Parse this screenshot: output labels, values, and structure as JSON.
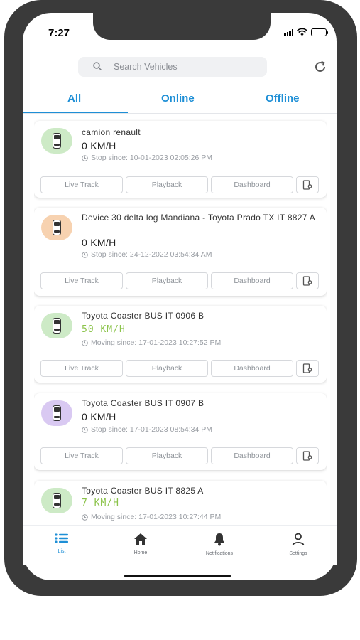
{
  "status_bar": {
    "time": "7:27"
  },
  "search": {
    "placeholder": "Search Vehicles"
  },
  "tabs": [
    {
      "label": "All",
      "active": true
    },
    {
      "label": "Online",
      "active": false
    },
    {
      "label": "Offline",
      "active": false
    }
  ],
  "colors": {
    "accent": "#1e8fd6",
    "moving": "#8bc34a",
    "avatar_green": "#cdeac6",
    "avatar_orange": "#f7d2b0",
    "avatar_purple": "#d9c9f2"
  },
  "actions": {
    "live_track": "Live Track",
    "playback": "Playback",
    "dashboard": "Dashboard"
  },
  "vehicles": [
    {
      "name": "camion renault",
      "speed": "0 KM/H",
      "since": "Stop since: 10-01-2023 02:05:26 PM",
      "status": "stopped",
      "avatar_color": "green"
    },
    {
      "name": "Device 30 delta log Mandiana - Toyota Prado TX IT 8827 A",
      "speed": "0 KM/H",
      "since": "Stop since: 24-12-2022 03:54:34 AM",
      "status": "stopped",
      "avatar_color": "orange"
    },
    {
      "name": "Toyota Coaster BUS IT 0906 B",
      "speed": "50 KM/H",
      "since": "Moving since: 17-01-2023 10:27:52 PM",
      "status": "moving",
      "avatar_color": "green"
    },
    {
      "name": "Toyota Coaster BUS IT 0907 B",
      "speed": "0 KM/H",
      "since": "Stop since: 17-01-2023 08:54:34 PM",
      "status": "stopped",
      "avatar_color": "purple"
    },
    {
      "name": "Toyota Coaster BUS IT 8825 A",
      "speed": "7 KM/H",
      "since": "Moving since: 17-01-2023 10:27:44 PM",
      "status": "moving",
      "avatar_color": "green"
    }
  ],
  "bottom_nav": [
    {
      "label": "List",
      "icon": "list-icon",
      "active": true
    },
    {
      "label": "Home",
      "icon": "home-icon",
      "active": false
    },
    {
      "label": "Notifications",
      "icon": "bell-icon",
      "active": false
    },
    {
      "label": "Settings",
      "icon": "user-icon",
      "active": false
    }
  ]
}
